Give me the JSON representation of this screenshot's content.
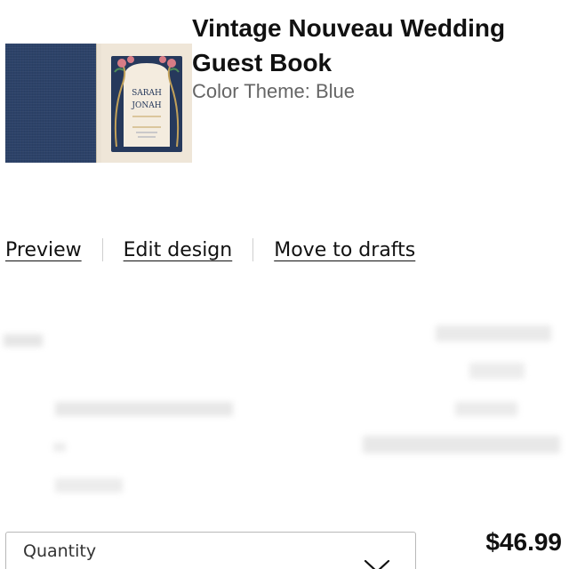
{
  "product": {
    "title": "Vintage Nouveau Wedding Guest Book",
    "subtitle": "Color Theme: Blue",
    "thumbnail": {
      "cover_color": "#2c4268",
      "page_color": "#efe6d8",
      "accent_color": "#c99fa0",
      "names_line_1": "SARAH",
      "names_line_2": "JONAH"
    }
  },
  "actions": {
    "preview": "Preview",
    "edit_design": "Edit design",
    "move_to_drafts": "Move to drafts"
  },
  "quantity": {
    "label": "Quantity",
    "icon": "chevron-down-icon"
  },
  "price": "$46.99"
}
